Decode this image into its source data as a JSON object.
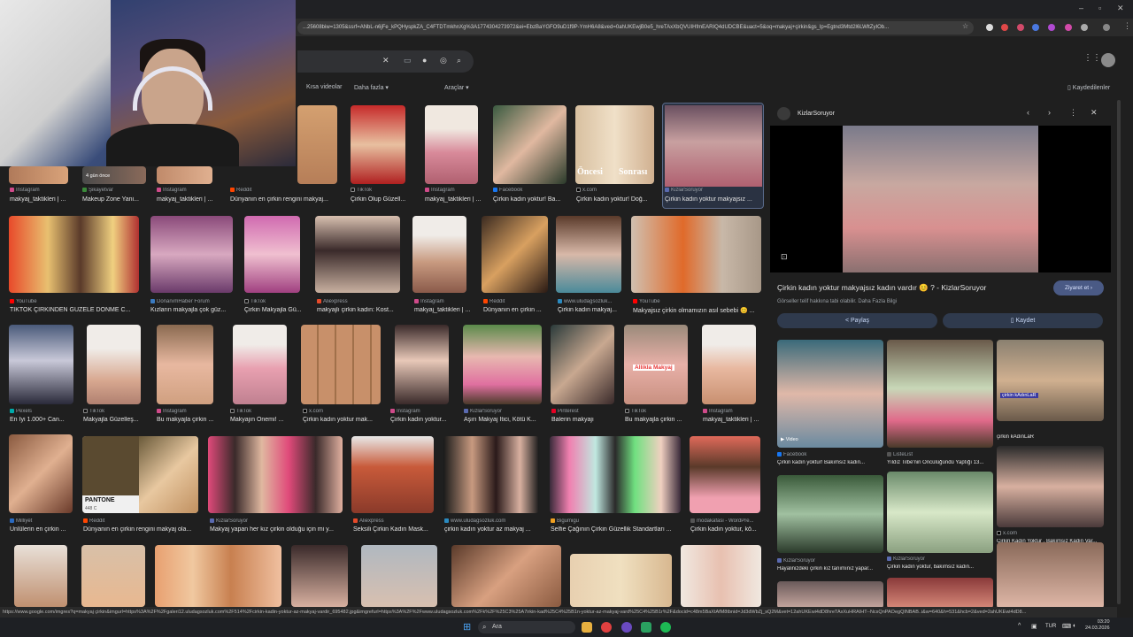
{
  "browser": {
    "url": "...25608biw=1305&ssrf=ANbL-n6jFe_kPQHyspkZA_C4FTDTmkhnXg%3A1774304273972&ei=EbzBaYGFO9uD1f9P-YmH6A8&ved=0ahUKEwjB0e5_hreTAxXbQVUIHfmEARIQ4dUDCBE&uact=5&oq=makyaj+çirkin&gs_lp=Egtnd3Mtd2l6LWltZyIOb...",
    "status_url": "https://www.google.com/imgres?q=makyaj çirkin&imgurl=https%3A%2F%2Fgaleri12.uludagsozluk.com%2F514%2Fcirkin-kadin-yoktur-az-makyaj-vardir_695482.jpg&imgrefurl=https%3A%2F%2Fwww.uludagsozluk.com%2Fk%2F%25C3%25A7irkin-kad%25C4%25B1n-yoktur-az-makyaj-vard%25C4%25B1r%2F&docid=c48m5BaXtAfM8tbnid=Jd3dWbZj_sQ2M&vet=12ahUKEwi4dD8hreTAxXuHRAIHT--NcsQnPAOegQINBAB..i&w=640&h=531&hcb=2&ved=2ahUKEwi4dD8..."
  },
  "search": {
    "tabs": [
      "Kısa videolar",
      "Daha fazla",
      "Araçlar"
    ],
    "saved_label": "Kaydedilenler"
  },
  "results": {
    "row1": [
      {
        "src": "Instagram",
        "cap": "makyaj_taktikleri | ..."
      },
      {
        "src": "Şikayetvar",
        "cap": "Makeup Zone Yani..."
      },
      {
        "src": "Instagram",
        "cap": "makyaj_taktikleri | ..."
      },
      {
        "src": "Reddit",
        "cap": "Dünyanın en çirkin rengini makyaj..."
      },
      {
        "src": "TikTok",
        "cap": "Çirkin Olup Güzell..."
      },
      {
        "src": "Instagram",
        "cap": "makyaj_taktikleri | ..."
      },
      {
        "src": "Facebook",
        "cap": "Çirkin kadın yoktur! Ba..."
      },
      {
        "src": "x.com",
        "cap": "Çirkin kadın yoktur! Doğ..."
      },
      {
        "src": "KizlarSoruyor",
        "cap": "Çirkin kadın yoktur makyajsız ..."
      }
    ],
    "row1_badges": {
      "gun": "4 gün önce",
      "oncesi": "Öncesi",
      "sonrasi": "Sonrası"
    },
    "row2": [
      {
        "src": "YouTube",
        "cap": "TİKTOK ÇİRKİNDEN GÜZELE DÖNME C..."
      },
      {
        "src": "DonanımHaber Forum",
        "cap": "Kızların makyajla çok güz..."
      },
      {
        "src": "TikTok",
        "cap": "Çirkin Makyajla Gü..."
      },
      {
        "src": "Aliexpress",
        "cap": "makyajlı çirkin kadın: Kost..."
      },
      {
        "src": "Instagram",
        "cap": "makyaj_taktikleri | ..."
      },
      {
        "src": "Reddit",
        "cap": "Dünyanın en çirkin ..."
      },
      {
        "src": "www.uludagsozluk...",
        "cap": "Çirkin kadın makyaj..."
      },
      {
        "src": "YouTube",
        "cap": "Makyajsız çirkin olmamızın asıl sebebi 😊 ..."
      }
    ],
    "row3": [
      {
        "src": "Pexels",
        "cap": "En İyi 1.000+ Can..."
      },
      {
        "src": "TikTok",
        "cap": "Makyajla Güzelleş..."
      },
      {
        "src": "Instagram",
        "cap": "Bu makyajla çirkin ..."
      },
      {
        "src": "TikTok",
        "cap": "Makyajın Önemi! ..."
      },
      {
        "src": "x.com",
        "cap": "Çirkin kadın yoktur mak..."
      },
      {
        "src": "Instagram",
        "cap": "Çirkin kadın yoktur..."
      },
      {
        "src": "KizlarSoruyor",
        "cap": "Aşırı Makyaj İtici, Kötü K..."
      },
      {
        "src": "Pinterest",
        "cap": "Balerin makyajı"
      },
      {
        "src": "TikTok",
        "cap": "Bu makyajla çirkin ..."
      },
      {
        "src": "Instagram",
        "cap": "makyaj_taktikleri | ..."
      }
    ],
    "row3_badge": "Allikla Makyaj",
    "row4": [
      {
        "src": "Milliyet",
        "cap": "Ünlülerin en çirkin ..."
      },
      {
        "src": "Reddit",
        "cap": "Dünyanın en çirkin rengini makyaj ola..."
      },
      {
        "src": "KizlarSoruyor",
        "cap": "Makyaj yapan her kız çirkin olduğu için mi y..."
      },
      {
        "src": "Aliexpress",
        "cap": "Seksili Çirkin Kadın Mask..."
      },
      {
        "src": "www.uludagsozluk.com",
        "cap": "çirkin kadın yoktur az makyaj ..."
      },
      {
        "src": "Bigumigu",
        "cap": "Selfie Çağının Çirkin Güzellik Standartları ..."
      },
      {
        "src": "modakafasi - WordPre...",
        "cap": "Çirkin kadın yoktur, kö..."
      }
    ],
    "pantone": {
      "label": "PANTONE",
      "code": "448 C"
    }
  },
  "panel": {
    "source": "KizlarSoruyor",
    "title": "Çirkin kadın yoktur makyajsız kadın vardır 😊 ? - KizlarSoruyor",
    "subtitle": "Görseller telif hakkına tabi olabilir. Daha Fazla Bilgi",
    "visit_label": "Ziyaret et",
    "share_label": "Paylaş",
    "save_label": "Kaydet",
    "related": [
      {
        "src": "Facebook",
        "cap": "Çirkin kadın yoktur! Bakımsız kadın...",
        "badge": "Video"
      },
      {
        "src": "ListeList",
        "cap": "Yıldız Tilbe'nin Öncülüğündü Yaptığı 13..."
      },
      {
        "src": "",
        "cap": "çirkin kAdınLaR"
      },
      {
        "src": "KizlarSoruyor",
        "cap": "Hayalinizdeki çirkin kız tanımınız yapar..."
      },
      {
        "src": "KizlarSoruyor",
        "cap": "Çirkin kadın yoktur, bakımsız kadın..."
      },
      {
        "src": "x.com",
        "cap": "Çirkin Kadın Yoktur , Bakımsız Kadın Var..."
      }
    ],
    "overlay_caption_3": "çirkin kAdınLaR"
  },
  "taskbar": {
    "search_label": "Ara",
    "lang": "TUR",
    "time": "03:20",
    "date": "24.03.2026"
  }
}
